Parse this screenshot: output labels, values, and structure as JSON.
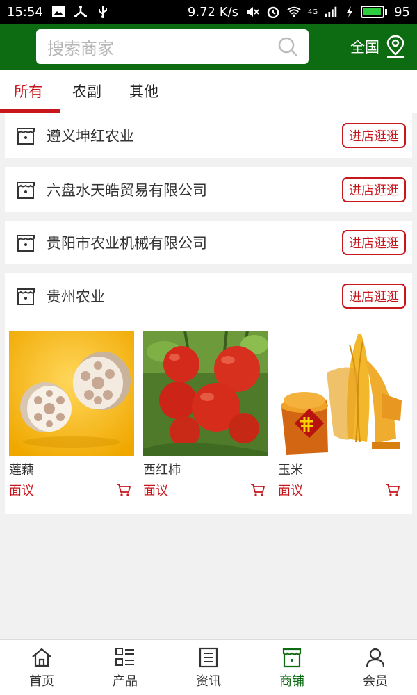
{
  "status_bar": {
    "time": "15:54",
    "speed": "9.72 K/s",
    "network": "4G",
    "battery": "95",
    "battery_level": 0.95,
    "icons": [
      "image-icon",
      "usb-share-icon",
      "usb-icon",
      "mute-icon",
      "alarm-icon",
      "wifi-icon",
      "signal-icon",
      "charging-icon",
      "battery-icon"
    ]
  },
  "header": {
    "search_placeholder": "搜索商家",
    "region_label": "全国",
    "colors": {
      "header_bg": "#0d6b12",
      "accent": "#c8161d"
    }
  },
  "tabs": [
    {
      "label": "所有",
      "active": true
    },
    {
      "label": "农副",
      "active": false
    },
    {
      "label": "其他",
      "active": false
    }
  ],
  "shops": [
    {
      "name": "遵义坤红农业",
      "enter_label": "进店逛逛"
    },
    {
      "name": "六盘水天皓贸易有限公司",
      "enter_label": "进店逛逛"
    },
    {
      "name": "贵阳市农业机械有限公司",
      "enter_label": "进店逛逛"
    },
    {
      "name": "贵州农业",
      "enter_label": "进店逛逛"
    }
  ],
  "products": [
    {
      "name": "莲藕",
      "price": "面议"
    },
    {
      "name": "西红柿",
      "price": "面议"
    },
    {
      "name": "玉米",
      "price": "面议",
      "badge": "丰"
    }
  ],
  "bottom_nav": [
    {
      "label": "首页",
      "icon": "home-icon",
      "active": false
    },
    {
      "label": "产品",
      "icon": "list-icon",
      "active": false
    },
    {
      "label": "资讯",
      "icon": "news-icon",
      "active": false
    },
    {
      "label": "商铺",
      "icon": "store-icon",
      "active": true
    },
    {
      "label": "会员",
      "icon": "user-icon",
      "active": false
    }
  ]
}
